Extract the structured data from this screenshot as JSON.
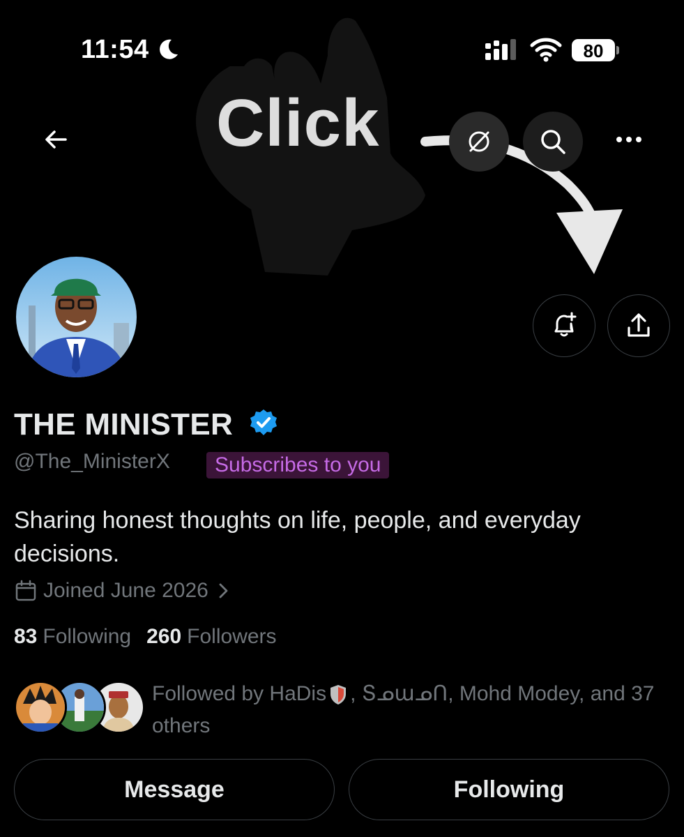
{
  "status_bar": {
    "time": "11:54",
    "battery": "80"
  },
  "overlay": {
    "text": "Click"
  },
  "profile": {
    "display_name": "THE MINISTER",
    "handle": "@The_MinisterX",
    "subscribes_badge": "Subscribes to you",
    "bio": "Sharing honest thoughts on life, people, and everyday decisions.",
    "joined": "Joined June 2026",
    "following_count": "83",
    "following_label": "Following",
    "followers_count": "260",
    "followers_label": "Followers",
    "followed_by_prefix": "Followed by HaDis",
    "followed_by_rest": ", Տᓄաᓄᑎ, Mohd Modey, and 37 others"
  },
  "actions": {
    "message": "Message",
    "following": "Following"
  },
  "colors": {
    "background": "#000000",
    "text": "#e7e9ea",
    "muted": "#71767b",
    "verified": "#1d9bf0",
    "badge_bg": "#3b1438",
    "badge_text": "#c66be6"
  },
  "icons": [
    "moon-icon",
    "signal-icon",
    "wifi-icon",
    "battery-icon",
    "back-arrow-icon",
    "grok-icon",
    "search-icon",
    "more-icon",
    "bell-plus-icon",
    "share-icon",
    "verified-badge-icon",
    "calendar-icon",
    "chevron-right-icon",
    "shield-icon"
  ]
}
